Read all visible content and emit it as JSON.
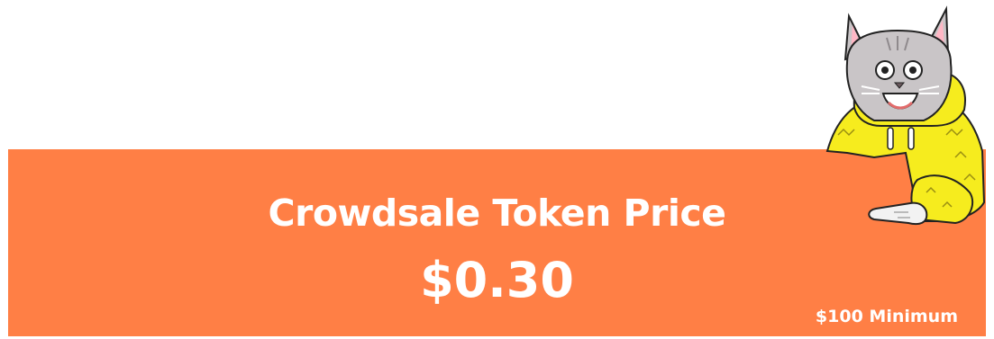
{
  "banner": {
    "title": "Crowdsale Token Price",
    "price": "$0.30",
    "minimum": "$100 Minimum",
    "background_color": "#ff7f45",
    "text_color": "#ffffff"
  },
  "mascot": {
    "icon": "cat-mascot-icon",
    "hoodie_color": "#f6ec1e",
    "fur_color": "#c9c5c7"
  }
}
